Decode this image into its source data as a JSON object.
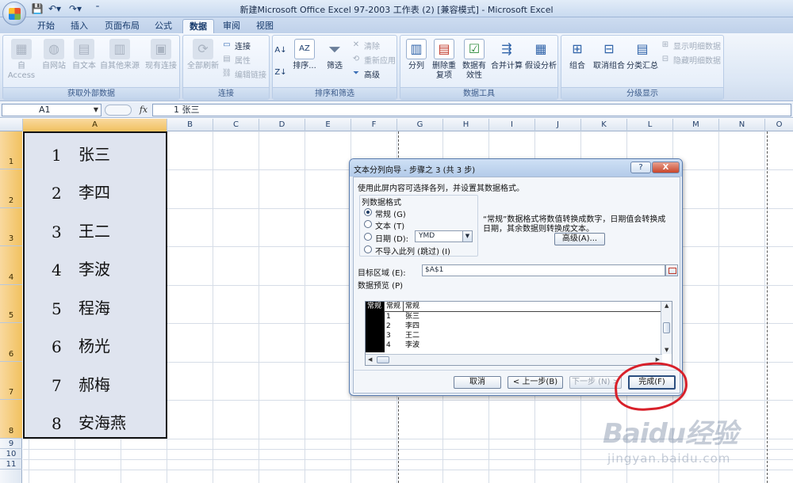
{
  "window": {
    "title": "新建Microsoft Office Excel 97-2003 工作表 (2)  [兼容模式] - Microsoft Excel"
  },
  "ribbon_tabs": [
    "开始",
    "插入",
    "页面布局",
    "公式",
    "数据",
    "审阅",
    "视图"
  ],
  "active_tab": "数据",
  "ribbon": {
    "get_external": {
      "label": "获取外部数据",
      "buttons": [
        "自 Access",
        "自网站",
        "自文本",
        "自其他来源",
        "现有连接"
      ]
    },
    "connections": {
      "label": "连接",
      "refresh_all": "全部刷新",
      "items": [
        "连接",
        "属性",
        "编辑链接"
      ]
    },
    "sort_filter": {
      "label": "排序和筛选",
      "sort": "排序...",
      "filter": "筛选",
      "items": [
        "清除",
        "重新应用",
        "高级"
      ]
    },
    "data_tools": {
      "label": "数据工具",
      "buttons": [
        "分列",
        "删除重复项",
        "数据有效性",
        "合并计算",
        "假设分析"
      ]
    },
    "outline": {
      "label": "分级显示",
      "buttons": [
        "组合",
        "取消组合",
        "分类汇总"
      ],
      "items": [
        "显示明细数据",
        "隐藏明细数据"
      ]
    }
  },
  "formula_bar": {
    "name_box": "A1",
    "fx": "fx",
    "content": "1   张三"
  },
  "sheet": {
    "columns": [
      "A",
      "B",
      "C",
      "D",
      "E",
      "F",
      "G",
      "H",
      "I",
      "J",
      "K",
      "L",
      "M",
      "N",
      "O"
    ],
    "rows": [
      "1",
      "2",
      "3",
      "4",
      "5",
      "6",
      "7",
      "8",
      "9",
      "10",
      "11"
    ],
    "cells": [
      {
        "num": "1",
        "name": "张三"
      },
      {
        "num": "2",
        "name": "李四"
      },
      {
        "num": "3",
        "name": "王二"
      },
      {
        "num": "4",
        "name": "李波"
      },
      {
        "num": "5",
        "name": "程海"
      },
      {
        "num": "6",
        "name": "杨光"
      },
      {
        "num": "7",
        "name": "郝梅"
      },
      {
        "num": "8",
        "name": "安海燕"
      }
    ]
  },
  "dialog": {
    "title": "文本分列向导 - 步骤之 3 (共 3 步)",
    "help": "?",
    "close": "X",
    "instruction": "使用此屏内容可选择各列，并设置其数据格式。",
    "format_group": "列数据格式",
    "options": [
      "常规 (G)",
      "文本 (T)",
      "日期 (D):",
      "不导入此列 (跳过) (I)"
    ],
    "selected_option": "常规 (G)",
    "date_format": "YMD",
    "note_line1": "“常规”数据格式将数值转换成数字，日期值会转换成",
    "note_line2": "日期，其余数据则转换成文本。",
    "advanced_button": "高级(A)...",
    "destination_label": "目标区域 (E):",
    "destination_value": "$A$1",
    "preview_label": "数据预览 (P)",
    "preview_headers": [
      "常规",
      "常规",
      "常规"
    ],
    "preview_rows": [
      {
        "c1": "1",
        "c2": "张三"
      },
      {
        "c1": "2",
        "c2": "李四"
      },
      {
        "c1": "3",
        "c2": "王二"
      },
      {
        "c1": "4",
        "c2": "李波"
      }
    ],
    "buttons": {
      "cancel": "取消",
      "back": "< 上一步(B)",
      "next": "下一步 (N) >",
      "finish": "完成(F)"
    }
  },
  "watermark": {
    "logo": "Baidu经验",
    "url": "jingyan.baidu.com"
  },
  "colors": {
    "annotation": "#d8202a",
    "selection_header": "#f1c15f",
    "ribbon": "#dce7f5"
  }
}
